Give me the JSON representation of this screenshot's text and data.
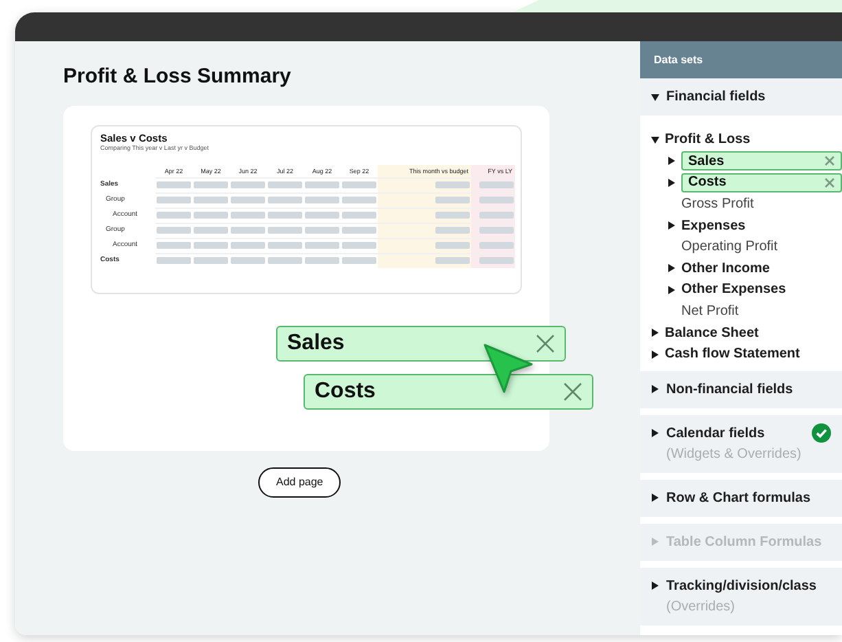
{
  "page": {
    "title": "Profit & Loss Summary",
    "report": {
      "title": "Sales v Costs",
      "subtitle": "Comparing This year v Last yr v Budget",
      "columns": [
        {
          "label": "Apr 22"
        },
        {
          "label": "May 22"
        },
        {
          "label": "Jun 22"
        },
        {
          "label": "Jul 22"
        },
        {
          "label": "Aug 22"
        },
        {
          "label": "Sep 22"
        },
        {
          "label": "This month vs budget",
          "color": "#fdf6e4"
        },
        {
          "label": "FY vs LY",
          "color": "#fbebee"
        }
      ],
      "rows": [
        {
          "label": "Sales",
          "kind": "total"
        },
        {
          "label": "Group",
          "kind": "group"
        },
        {
          "label": "Account",
          "kind": "account"
        },
        {
          "label": "Group",
          "kind": "group"
        },
        {
          "label": "Account",
          "kind": "account"
        },
        {
          "label": "Costs",
          "kind": "total"
        }
      ]
    },
    "add_button": "Add page"
  },
  "drag_chips": [
    {
      "label": "Sales"
    },
    {
      "label": "Costs"
    }
  ],
  "sidebar": {
    "title": "Data sets",
    "sections": [
      {
        "label": "Financial fields",
        "expanded": true,
        "disabled": false,
        "checked": false,
        "children": [
          {
            "label": "Profit & Loss",
            "kind": "folder",
            "expanded": true,
            "selected": false,
            "children": [
              {
                "label": "Sales",
                "kind": "folder",
                "expanded": false,
                "selected": true
              },
              {
                "label": "Costs",
                "kind": "folder",
                "expanded": false,
                "selected": true
              },
              {
                "label": "Gross Profit",
                "kind": "leaf",
                "selected": false
              },
              {
                "label": "Expenses",
                "kind": "folder",
                "expanded": false,
                "selected": false
              },
              {
                "label": "Operating Profit",
                "kind": "leaf",
                "selected": false
              },
              {
                "label": "Other Income",
                "kind": "folder",
                "expanded": false,
                "selected": false
              },
              {
                "label": "Other Expenses",
                "kind": "folder",
                "expanded": false,
                "selected": false
              },
              {
                "label": "Net Profit",
                "kind": "leaf",
                "selected": false
              }
            ]
          },
          {
            "label": "Balance Sheet",
            "kind": "folder",
            "expanded": false,
            "selected": false
          },
          {
            "label": "Cash flow Statement",
            "kind": "folder",
            "expanded": false,
            "selected": false
          }
        ]
      },
      {
        "label": "Non-financial fields",
        "expanded": false,
        "disabled": false,
        "checked": false
      },
      {
        "label": "Calendar fields",
        "subtitle": "(Widgets & Overrides)",
        "expanded": false,
        "disabled": false,
        "checked": true
      },
      {
        "label": "Row & Chart formulas",
        "expanded": false,
        "disabled": false,
        "checked": false
      },
      {
        "label": "Table Column Formulas",
        "expanded": false,
        "disabled": true,
        "checked": false
      },
      {
        "label": "Tracking/division/class",
        "subtitle": "(Overrides)",
        "expanded": false,
        "disabled": false,
        "checked": false
      }
    ]
  }
}
